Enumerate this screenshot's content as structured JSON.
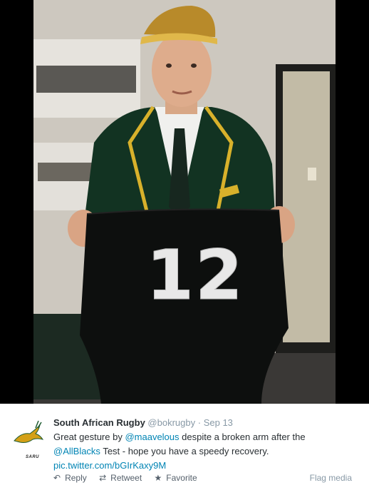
{
  "tweet": {
    "name": "South African Rugby",
    "handle": "@bokrugby",
    "separator": "·",
    "date": "Sep 13",
    "text_part1": "Great gesture by ",
    "mention1": "@maavelous",
    "text_part2": " despite a broken arm after the",
    "mention2": "@AllBlacks",
    "text_part3": " Test - hope you have a speedy recovery.",
    "link": "pic.twitter.com/bGIrKaxy9M",
    "logo_text": "SARU"
  },
  "photo": {
    "jersey_number": "12"
  },
  "actions": {
    "reply": "Reply",
    "retweet": "Retweet",
    "favorite": "Favorite",
    "flag": "Flag media"
  },
  "colors": {
    "link": "#0084b4",
    "text": "#292f33",
    "muted": "#8899a6"
  }
}
